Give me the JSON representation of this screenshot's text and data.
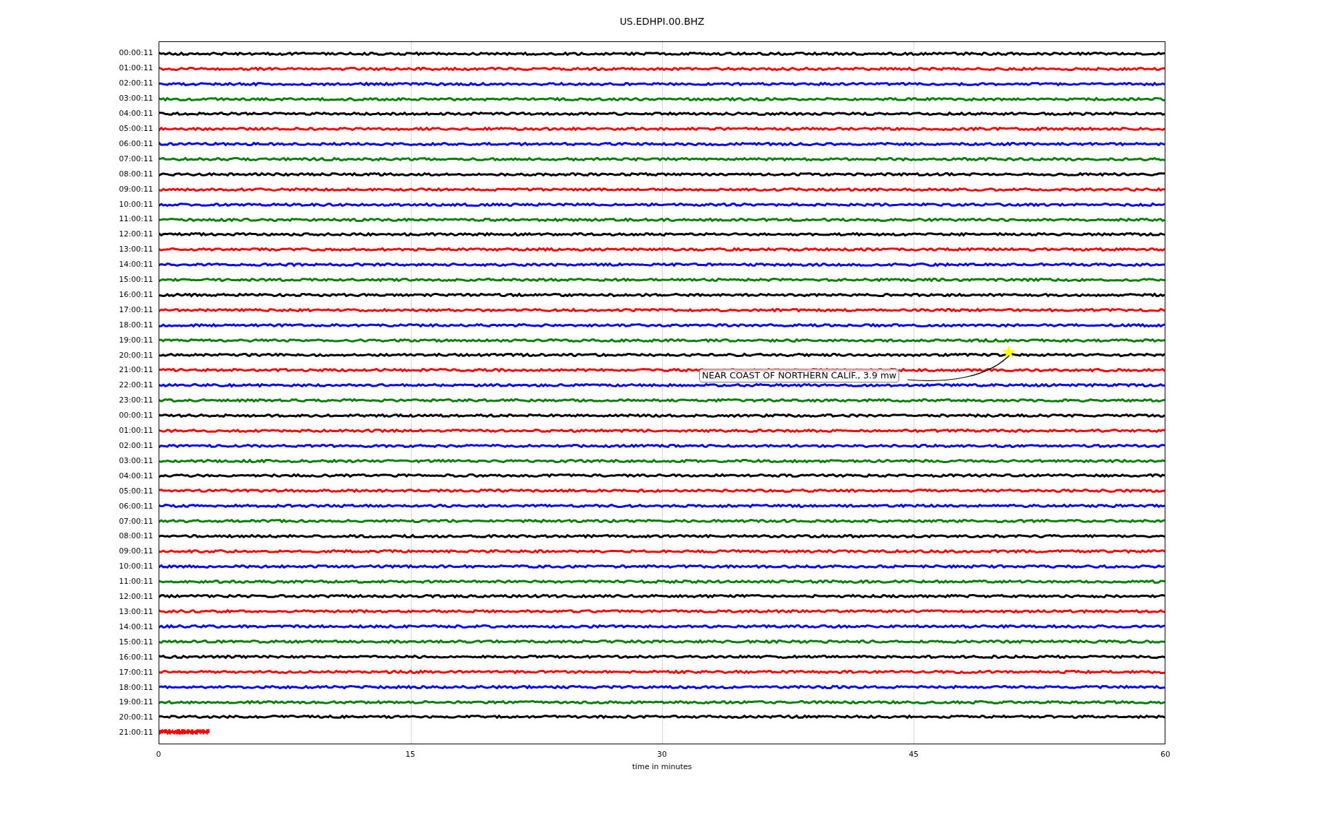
{
  "title": "US.EDHPI.00.BHZ",
  "plot": {
    "rows": [
      {
        "label": "00:00:11",
        "color": "#000000",
        "level": 1
      },
      {
        "label": "01:00:11",
        "color": "#ff0000",
        "level": 1
      },
      {
        "label": "02:00:11",
        "color": "#0000ff",
        "level": 1
      },
      {
        "label": "03:00:11",
        "color": "#008000",
        "level": 1
      },
      {
        "label": "04:00:11",
        "color": "#000000",
        "level": 1
      },
      {
        "label": "05:00:11",
        "color": "#ff0000",
        "level": 1
      },
      {
        "label": "06:00:11",
        "color": "#0000ff",
        "level": 1
      },
      {
        "label": "07:00:11",
        "color": "#008000",
        "level": 1
      },
      {
        "label": "08:00:11",
        "color": "#000000",
        "level": 1
      },
      {
        "label": "09:00:11",
        "color": "#ff0000",
        "level": 1
      },
      {
        "label": "10:00:11",
        "color": "#0000ff",
        "level": 1
      },
      {
        "label": "11:00:11",
        "color": "#008000",
        "level": 1
      },
      {
        "label": "12:00:11",
        "color": "#000000",
        "level": 1
      },
      {
        "label": "13:00:11",
        "color": "#ff0000",
        "level": 1
      },
      {
        "label": "14:00:11",
        "color": "#0000ff",
        "level": 1
      },
      {
        "label": "15:00:11",
        "color": "#008000",
        "level": 1
      },
      {
        "label": "16:00:11",
        "color": "#000000",
        "level": 1
      },
      {
        "label": "17:00:11",
        "color": "#ff0000",
        "level": 1
      },
      {
        "label": "18:00:11",
        "color": "#0000ff",
        "level": 1
      },
      {
        "label": "19:00:11",
        "color": "#008000",
        "level": 1
      },
      {
        "label": "20:00:11",
        "color": "#000000",
        "level": 1
      },
      {
        "label": "21:00:11",
        "color": "#ff0000",
        "level": 1
      },
      {
        "label": "22:00:11",
        "color": "#0000ff",
        "level": 1
      },
      {
        "label": "23:00:11",
        "color": "#008000",
        "level": 1
      },
      {
        "label": "00:00:11",
        "color": "#000000",
        "level": 1
      },
      {
        "label": "01:00:11",
        "color": "#ff0000",
        "level": 1
      },
      {
        "label": "02:00:11",
        "color": "#0000ff",
        "level": 1
      },
      {
        "label": "03:00:11",
        "color": "#008000",
        "level": 1
      },
      {
        "label": "04:00:11",
        "color": "#000000",
        "level": 1
      },
      {
        "label": "05:00:11",
        "color": "#ff0000",
        "level": 1
      },
      {
        "label": "06:00:11",
        "color": "#0000ff",
        "level": 1
      },
      {
        "label": "07:00:11",
        "color": "#008000",
        "level": 1
      },
      {
        "label": "08:00:11",
        "color": "#000000",
        "level": 1
      },
      {
        "label": "09:00:11",
        "color": "#ff0000",
        "level": 1
      },
      {
        "label": "10:00:11",
        "color": "#0000ff",
        "level": 1
      },
      {
        "label": "11:00:11",
        "color": "#008000",
        "level": 1
      },
      {
        "label": "12:00:11",
        "color": "#000000",
        "level": 1
      },
      {
        "label": "13:00:11",
        "color": "#ff0000",
        "level": 1
      },
      {
        "label": "14:00:11",
        "color": "#0000ff",
        "level": 1
      },
      {
        "label": "15:00:11",
        "color": "#008000",
        "level": 1
      },
      {
        "label": "16:00:11",
        "color": "#000000",
        "level": 1
      },
      {
        "label": "17:00:11",
        "color": "#ff0000",
        "level": 1
      },
      {
        "label": "18:00:11",
        "color": "#0000ff",
        "level": 1
      },
      {
        "label": "19:00:11",
        "color": "#008000",
        "level": 1
      },
      {
        "label": "20:00:11",
        "color": "#000000",
        "level": 1
      },
      {
        "label": "21:00:11",
        "color": "#ff0000",
        "level": 0.05
      }
    ],
    "xticks": [
      "0",
      "15",
      "30",
      "45",
      "60"
    ],
    "xlabel": "time in minutes",
    "annotation": {
      "text": "NEAR COAST OF NORTHERN CALIF., 3.9 mw"
    }
  }
}
